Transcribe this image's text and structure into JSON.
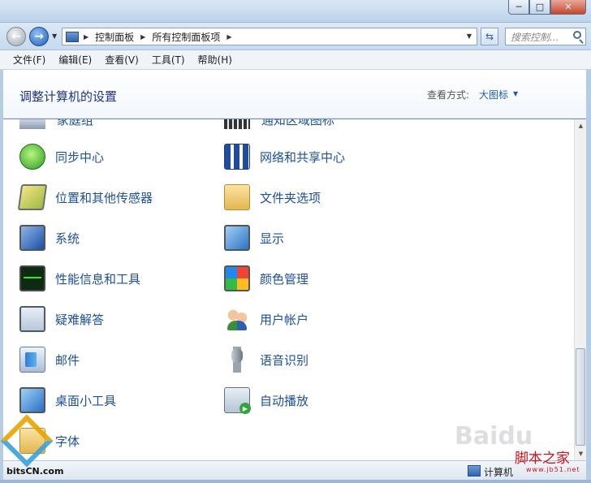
{
  "window": {
    "minimize": "─",
    "maximize": "□",
    "close": "✕"
  },
  "nav": {
    "back_icon": "arrow-left-icon",
    "forward_icon": "arrow-right-icon",
    "breadcrumbs": [
      "控制面板",
      "所有控制面板项"
    ],
    "search_placeholder": "搜索控制..."
  },
  "menu": [
    "文件(F)",
    "编辑(E)",
    "查看(V)",
    "工具(T)",
    "帮助(H)"
  ],
  "header": {
    "title": "调整计算机的设置",
    "view_label": "查看方式:",
    "view_value": "大图标"
  },
  "items": {
    "partial_left": "家庭组",
    "partial_right": "通知区域图标",
    "left": [
      "同步中心",
      "位置和其他传感器",
      "系统",
      "性能信息和工具",
      "疑难解答",
      "邮件",
      "桌面小工具",
      "字体"
    ],
    "right": [
      "网络和共享中心",
      "文件夹选项",
      "显示",
      "颜色管理",
      "用户帐户",
      "语音识别",
      "自动播放"
    ]
  },
  "status": {
    "text": "计算机"
  },
  "watermarks": {
    "bits": "bitsCN.com",
    "baidu": "Baidu",
    "jb": "脚本之家",
    "jb_site": "www.jb51.net"
  },
  "colors": {
    "link": "#1c4f9c",
    "title": "#1e3287",
    "accent": "#1e5bb8"
  }
}
